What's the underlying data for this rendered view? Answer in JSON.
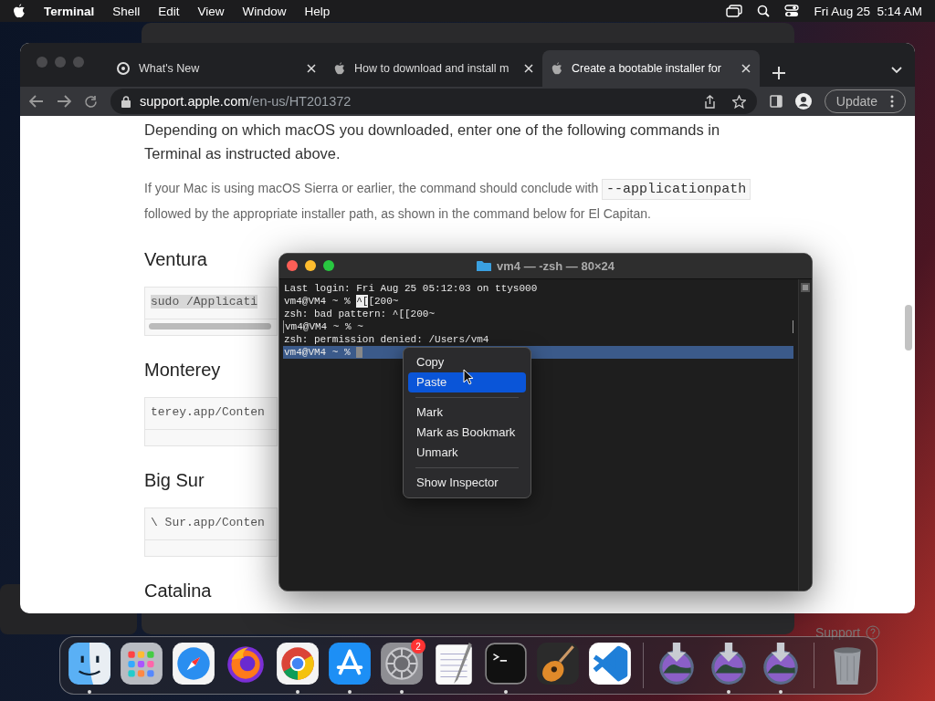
{
  "menu_bar": {
    "app": "Terminal",
    "items": [
      "Shell",
      "Edit",
      "View",
      "Window",
      "Help"
    ],
    "clock": "Fri Aug 25  5:14 AM"
  },
  "background_window": {
    "link": "Support"
  },
  "browser": {
    "tabs": [
      {
        "title": "What's New",
        "kind": "chrome",
        "selected": false
      },
      {
        "title": "How to download and install m",
        "kind": "apple",
        "selected": false
      },
      {
        "title": "Create a bootable installer for",
        "kind": "apple",
        "selected": true
      }
    ],
    "url": {
      "host": "support.apple.com",
      "path": "/en-us/HT201372"
    },
    "update_button": "Update",
    "page": {
      "intro": "Depending on which macOS you downloaded, enter one of the following commands in Terminal as instructed above.",
      "note": {
        "before": "If your Mac is using macOS Sierra or earlier, the command should conclude with",
        "code": "--applicationpath",
        "after": "followed by the appropriate installer path, as shown in the command below for El Capitan."
      },
      "sections": [
        {
          "heading": "Ventura",
          "code": "sudo /Applicati",
          "selected": true
        },
        {
          "heading": "Monterey",
          "code": "terey.app/Conten",
          "selected": false
        },
        {
          "heading": "Big Sur",
          "code": "\\ Sur.app/Conten",
          "selected": false
        },
        {
          "heading": "Catalina"
        }
      ]
    }
  },
  "terminal": {
    "title": "vm4 — -zsh — 80×24",
    "lines": [
      {
        "kind": "text",
        "segments": [
          {
            "text": "Last login: Fri Aug 25 05:12:03 on ttys000",
            "inverse": false
          }
        ]
      },
      {
        "kind": "text",
        "segments": [
          {
            "text": "vm4@VM4 ~ % ",
            "inverse": false
          },
          {
            "text": "^[",
            "inverse": true
          },
          {
            "text": "[200~",
            "inverse": false
          }
        ]
      },
      {
        "kind": "text",
        "segments": [
          {
            "text": "zsh: bad pattern: ^[[200~",
            "inverse": false
          }
        ]
      },
      {
        "kind": "bookmarked",
        "segments": [
          {
            "text": "vm4@VM4 ~ % ~",
            "inverse": false
          }
        ]
      },
      {
        "kind": "text",
        "segments": [
          {
            "text": "zsh: permission denied: /Users/vm4",
            "inverse": false
          }
        ]
      },
      {
        "kind": "selected",
        "segments": [
          {
            "text": "vm4@VM4 ~ % ",
            "inverse": false
          }
        ]
      }
    ]
  },
  "context_menu": {
    "groups": [
      {
        "items": [
          {
            "label": "Copy",
            "selected": false
          },
          {
            "label": "Paste",
            "selected": true
          }
        ]
      },
      {
        "items": [
          {
            "label": "Mark",
            "selected": false
          },
          {
            "label": "Mark as Bookmark",
            "selected": false
          },
          {
            "label": "Unmark",
            "selected": false
          }
        ]
      },
      {
        "items": [
          {
            "label": "Show Inspector",
            "selected": false
          }
        ]
      }
    ]
  },
  "dock": {
    "groups": [
      {
        "items": [
          {
            "kind": "finder",
            "running": true
          },
          {
            "kind": "launchpad",
            "running": false
          },
          {
            "kind": "safari",
            "running": false
          },
          {
            "kind": "firefox",
            "running": false
          },
          {
            "kind": "chrome",
            "running": true
          },
          {
            "kind": "appstore",
            "running": true
          },
          {
            "kind": "settings",
            "running": true,
            "badge": "2"
          },
          {
            "kind": "textedit",
            "running": false
          },
          {
            "kind": "terminal",
            "running": true
          },
          {
            "kind": "guitar",
            "running": false
          },
          {
            "kind": "vscode",
            "running": false
          }
        ]
      },
      {
        "items": [
          {
            "kind": "installer",
            "running": false
          },
          {
            "kind": "installer",
            "running": true
          },
          {
            "kind": "installer",
            "running": true
          }
        ]
      },
      {
        "items": [
          {
            "kind": "trash",
            "running": false
          }
        ]
      }
    ]
  }
}
